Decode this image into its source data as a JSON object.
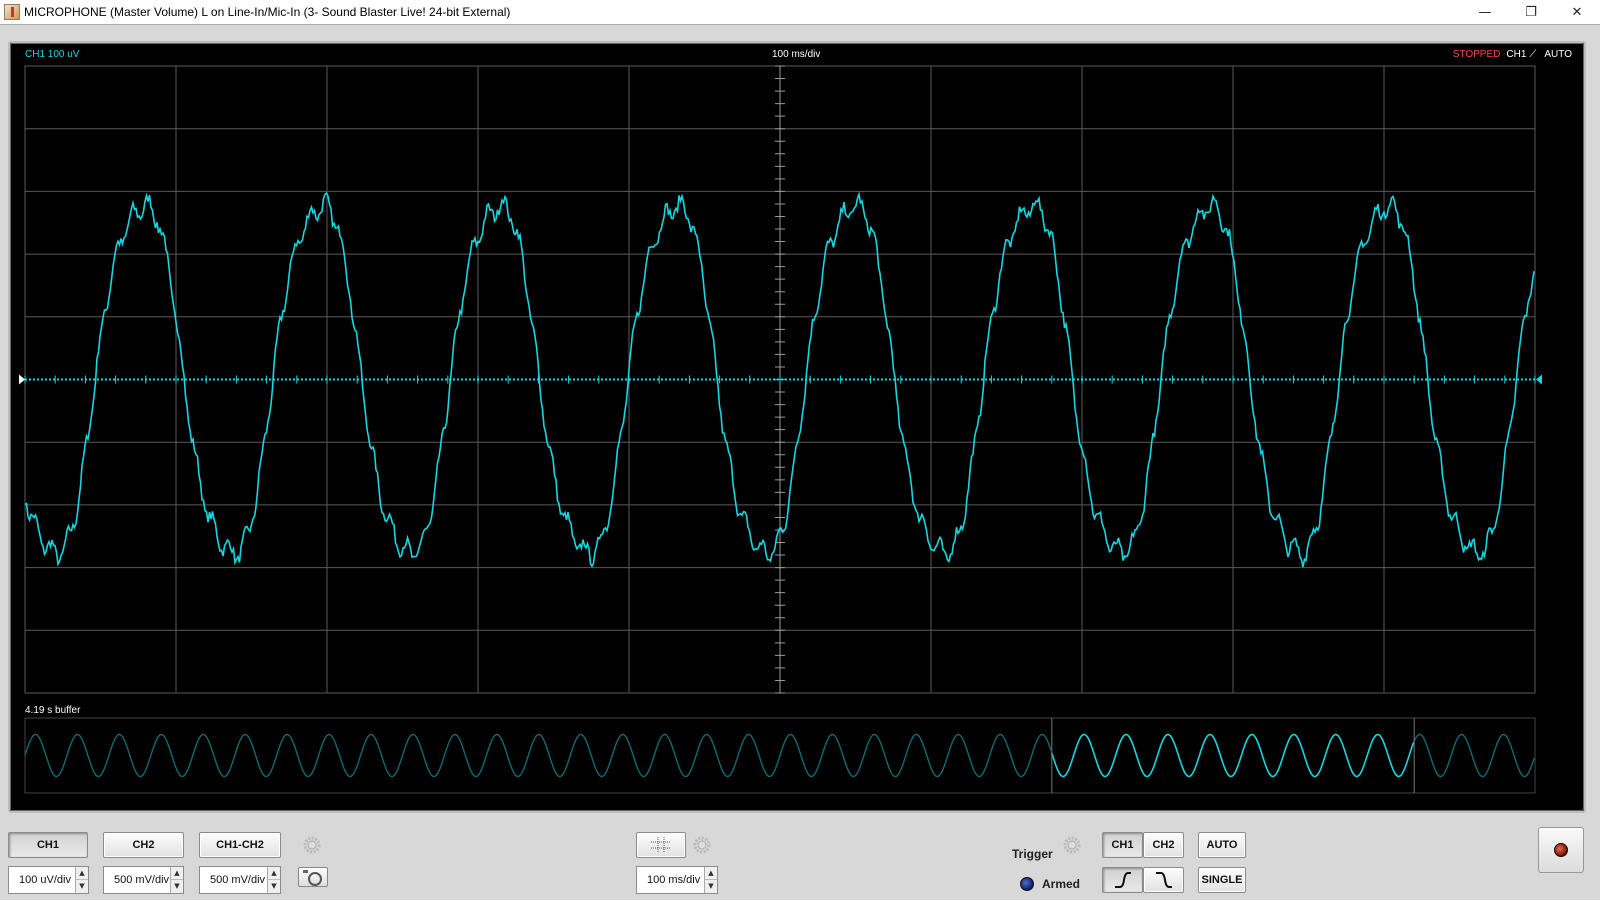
{
  "window": {
    "title": "MICROPHONE (Master Volume) L on Line-In/Mic-In (3- Sound Blaster Live! 24-bit External)",
    "min_glyph": "—",
    "max_glyph": "❐",
    "close_glyph": "✕"
  },
  "scope": {
    "ch_label": "CH1 100 uV",
    "timebase_label": "100 ms/div",
    "status_stopped": "STOPPED",
    "trig_channel": "CH1",
    "trig_edge_glyph": "⟋",
    "trig_mode": "AUTO",
    "buffer_label": "4.19 s buffer",
    "trace_color": "#17d7e0",
    "grid_color": "#5a5a5a"
  },
  "chart_data": {
    "type": "line",
    "x_divisions": 10,
    "y_divisions": 10,
    "grid": true,
    "series": [
      {
        "cycles_in_view": 8.5,
        "amplitude_div": 2.9,
        "offset_div": 0,
        "phase_start": "negative slope near -1.7 div"
      }
    ],
    "buffer_view": {
      "cycles": 36,
      "highlight_start_fraction": 0.68,
      "highlight_end_fraction": 0.92
    }
  },
  "controls": {
    "ch1": "CH1",
    "ch2": "CH2",
    "ch1_ch2": "CH1-CH2",
    "ch1_scale": "100 uV/div",
    "ch2_scale": "500 mV/div",
    "diff_scale": "500 mV/div",
    "time_scale": "100 ms/div",
    "trigger_label": "Trigger",
    "trig_ch1": "CH1",
    "trig_ch2": "CH2",
    "auto": "AUTO",
    "single": "SINGLE",
    "armed_label": "Armed",
    "up_arrow": "▲",
    "down_arrow": "▼"
  }
}
